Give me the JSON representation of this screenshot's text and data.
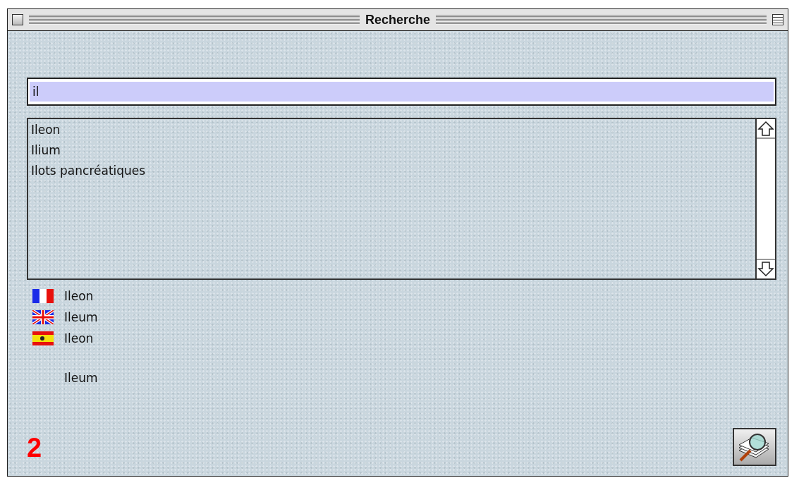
{
  "window": {
    "title": "Recherche"
  },
  "search": {
    "value": "il"
  },
  "results": [
    {
      "text": "Ileon"
    },
    {
      "text": "Ilium"
    },
    {
      "text": "Ilots pancréatiques"
    }
  ],
  "translations": [
    {
      "kind": "fr",
      "text": "Ileon"
    },
    {
      "kind": "gb",
      "text": "Ileum"
    },
    {
      "kind": "es",
      "text": "Ileon"
    },
    {
      "kind": "plain",
      "text": "Ileum"
    }
  ],
  "count": "2"
}
